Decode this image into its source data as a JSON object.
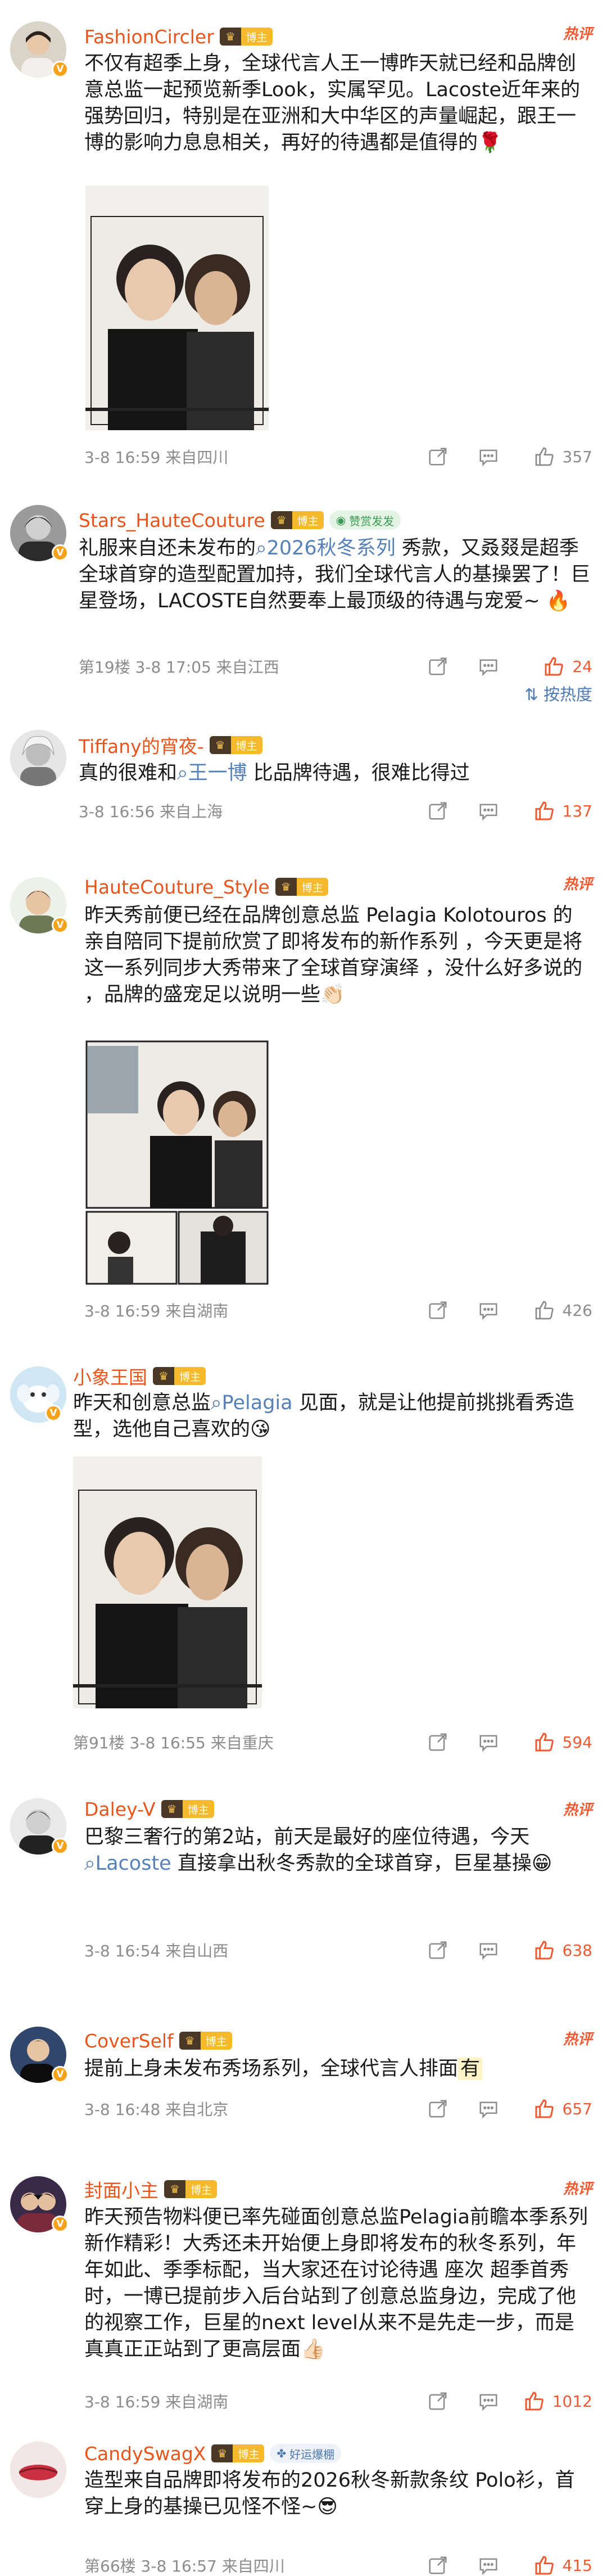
{
  "comments": [
    {
      "username": "FashionCircler",
      "mblog_label": "博主",
      "hot": "热评",
      "text": "不仅有超季上身，全球代言人王一博昨天就已经和品牌创意总监一起预览新季Look，实属罕见。Lacoste近年来的强势回归，特别是在亚洲和大中华区的声量崛起，跟王一博的影响力息息相关，再好的待遇都是值得的🌹",
      "meta": "3-8 16:59  来自四川",
      "likes": "357"
    },
    {
      "username": "Stars_HauteCouture",
      "mblog_label": "博主",
      "tag": "赞赏发发",
      "text_parts": [
        "礼服来自还未发布的",
        "2026秋冬系列",
        " 秀款，又叒叕是超季全球首穿的造型配置加持，我们全球代言人的基操罢了！巨星登场，LACOSTE自然要奉上最顶级的待遇与宠爱~ 🔥"
      ],
      "meta": "第19楼  3-8 17:05  来自江西",
      "likes": "24",
      "sort_label": "按热度"
    },
    {
      "username": "Tiffany的宵夜-",
      "mblog_label": "博主",
      "text_parts": [
        "真的很难和",
        "王一博",
        " 比品牌待遇，很难比得过"
      ],
      "meta": "3-8 16:56  来自上海",
      "likes": "137"
    },
    {
      "username": "HauteCouture_Style",
      "mblog_label": "博主",
      "hot": "热评",
      "text": "昨天秀前便已经在品牌创意总监 Pelagia Kolotouros 的亲自陪同下提前欣赏了即将发布的新作系列 ，今天更是将这一系列同步大秀带来了全球首穿演绎 ，没什么好多说的 ，品牌的盛宠足以说明一些👏🏻",
      "meta": "3-8 16:59  来自湖南",
      "likes": "426"
    },
    {
      "username": "小象王国",
      "mblog_label": "博主",
      "text_parts": [
        "昨天和创意总监",
        "Pelagia",
        " 见面，就是让他提前挑挑看秀造型，选他自己喜欢的😘"
      ],
      "meta": "第91楼  3-8 16:55  来自重庆",
      "likes": "594"
    },
    {
      "username": "Daley-V",
      "mblog_label": "博主",
      "hot": "热评",
      "text_parts": [
        "巴黎三奢行的第2站，前天是最好的座位待遇，今天",
        "Lacoste",
        " 直接拿出秋冬秀款的全球首穿，巨星基操😁"
      ],
      "meta": "3-8 16:54  来自山西",
      "likes": "638"
    },
    {
      "username": "CoverSelf",
      "mblog_label": "博主",
      "hot": "热评",
      "text_parts": [
        "提前上身未发布秀场系列，全球代言人排面",
        "有"
      ],
      "meta": "3-8 16:48  来自北京",
      "likes": "657"
    },
    {
      "username": "封面小主",
      "mblog_label": "博主",
      "hot": "热评",
      "text": "昨天预告物料便已率先碰面创意总监Pelagia前瞻本季系列新作精彩！大秀还未开始便上身即将发布的秋冬系列，年年如此、季季标配，当大家还在讨论待遇 座次 超季首秀时，一博已提前步入后台站到了创意总监身边，完成了他的视察工作，巨星的next level从来不是先走一步，而是真真正正站到了更高层面👍🏻",
      "meta": "3-8 16:59  来自湖南",
      "likes": "1012"
    },
    {
      "username": "CandySwagX",
      "mblog_label": "博主",
      "tag": "好运爆棚",
      "text": "造型来自品牌即将发布的2026秋冬新款条纹 Polo衫，首穿上身的基操已见怪不怪~😎",
      "meta": "第66楼  3-8 16:57  来自四川",
      "likes": "415"
    }
  ],
  "colors": {
    "username": "#e8551c",
    "link": "#5580b8",
    "hot": "#f05a32",
    "meta": "#8c8c8c"
  }
}
